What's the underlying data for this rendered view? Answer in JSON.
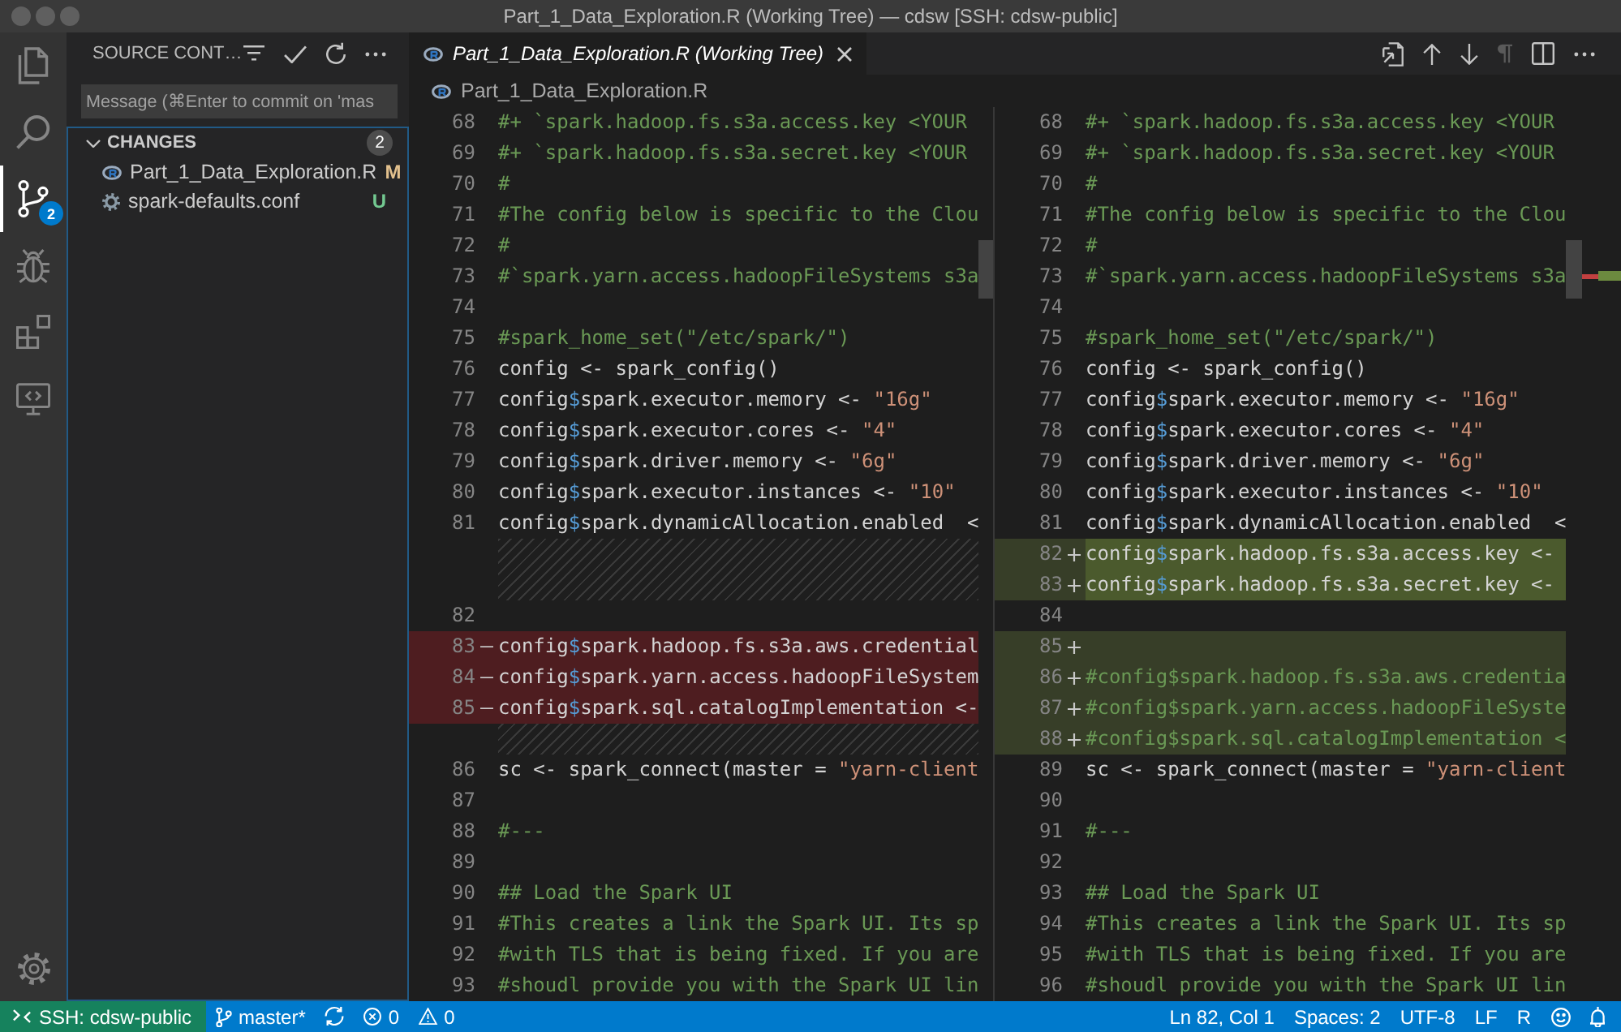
{
  "window": {
    "title": "Part_1_Data_Exploration.R (Working Tree) — cdsw [SSH: cdsw-public]"
  },
  "activity_bar": {
    "items": [
      {
        "kind": "explorer",
        "selected": false
      },
      {
        "kind": "search",
        "selected": false
      },
      {
        "kind": "scm",
        "selected": true,
        "badge": "2"
      },
      {
        "kind": "debug",
        "selected": false
      },
      {
        "kind": "extensions",
        "selected": false
      },
      {
        "kind": "remote",
        "selected": false
      }
    ]
  },
  "sidebar": {
    "title": "SOURCE CONT…",
    "commit_message": {
      "placeholder": "Message (⌘Enter to commit on 'mas"
    },
    "changes": {
      "label": "CHANGES",
      "count": "2",
      "expanded": true,
      "files": [
        {
          "name": "Part_1_Data_Exploration.R",
          "kind": "r",
          "status": "M",
          "color": "#e2c08d",
          "selected": false
        },
        {
          "name": "spark-defaults.conf",
          "kind": "conf",
          "status": "U",
          "color": "#73c991",
          "selected": false
        }
      ]
    }
  },
  "editor": {
    "tabs": [
      {
        "label": "Part_1_Data_Exploration.R (Working Tree)",
        "kind": "r",
        "selected": true
      }
    ],
    "actions": [
      {
        "kind": "open",
        "disabled": false
      },
      {
        "kind": "previous",
        "disabled": false
      },
      {
        "kind": "next",
        "disabled": false
      },
      {
        "kind": "whitespace",
        "disabled": true
      },
      {
        "kind": "split",
        "disabled": false
      },
      {
        "kind": "more",
        "disabled": false
      }
    ],
    "breadcrumb": [
      {
        "label": "Part_1_Data_Exploration.R",
        "kind": "r"
      }
    ],
    "diff": {
      "original": [
        {
          "number": "68",
          "kind": "context",
          "text": "#+ `spark.hadoop.fs.s3a.access.key <YOUR"
        },
        {
          "number": "69",
          "kind": "context",
          "text": "#+ `spark.hadoop.fs.s3a.secret.key <YOUR"
        },
        {
          "number": "70",
          "kind": "context",
          "text": "#"
        },
        {
          "number": "71",
          "kind": "context",
          "text": "#The config below is specific to the Clou"
        },
        {
          "number": "72",
          "kind": "context",
          "text": "#"
        },
        {
          "number": "73",
          "kind": "context",
          "text": "#`spark.yarn.access.hadoopFileSystems s3a"
        },
        {
          "number": "74",
          "kind": "context"
        },
        {
          "number": "75",
          "kind": "context",
          "text": "#spark_home_set(\"/etc/spark/\")"
        },
        {
          "number": "76",
          "kind": "context",
          "text": "config <- spark_config()"
        },
        {
          "number": "77",
          "kind": "context",
          "text": "config$spark.executor.memory <- \"16g\""
        },
        {
          "number": "78",
          "kind": "context",
          "text": "config$spark.executor.cores <- \"4\""
        },
        {
          "number": "79",
          "kind": "context",
          "text": "config$spark.driver.memory <- \"6g\""
        },
        {
          "number": "80",
          "kind": "context",
          "text": "config$spark.executor.instances <- \"10\""
        },
        {
          "number": "81",
          "kind": "context",
          "text": "config$spark.dynamicAllocation.enabled  <"
        },
        {
          "kind": "filler"
        },
        {
          "kind": "filler"
        },
        {
          "number": "82",
          "kind": "context"
        },
        {
          "number": "83",
          "kind": "removed",
          "text": "config$spark.hadoop.fs.s3a.aws.credential"
        },
        {
          "number": "84",
          "kind": "removed",
          "text": "config$spark.yarn.access.hadoopFileSystem"
        },
        {
          "number": "85",
          "kind": "removed",
          "text": "config$spark.sql.catalogImplementation <-"
        },
        {
          "kind": "filler"
        },
        {
          "number": "86",
          "kind": "context",
          "text": "sc <- spark_connect(master = \"yarn-client"
        },
        {
          "number": "87",
          "kind": "context"
        },
        {
          "number": "88",
          "kind": "context",
          "text": "#---"
        },
        {
          "number": "89",
          "kind": "context"
        },
        {
          "number": "90",
          "kind": "context",
          "text": "## Load the Spark UI"
        },
        {
          "number": "91",
          "kind": "context",
          "text": "#This creates a link the Spark UI. Its sp"
        },
        {
          "number": "92",
          "kind": "context",
          "text": "#with TLS that is being fixed. If you are"
        },
        {
          "number": "93",
          "kind": "context",
          "text": "#shoudl provide you with the Spark UI lin"
        }
      ],
      "modified": [
        {
          "number": "68",
          "kind": "context",
          "text": "#+ `spark.hadoop.fs.s3a.access.key <YOUR"
        },
        {
          "number": "69",
          "kind": "context",
          "text": "#+ `spark.hadoop.fs.s3a.secret.key <YOUR"
        },
        {
          "number": "70",
          "kind": "context",
          "text": "#"
        },
        {
          "number": "71",
          "kind": "context",
          "text": "#The config below is specific to the Clou"
        },
        {
          "number": "72",
          "kind": "context",
          "text": "#"
        },
        {
          "number": "73",
          "kind": "context",
          "text": "#`spark.yarn.access.hadoopFileSystems s3a"
        },
        {
          "number": "74",
          "kind": "context"
        },
        {
          "number": "75",
          "kind": "context",
          "text": "#spark_home_set(\"/etc/spark/\")"
        },
        {
          "number": "76",
          "kind": "context",
          "text": "config <- spark_config()"
        },
        {
          "number": "77",
          "kind": "context",
          "text": "config$spark.executor.memory <- \"16g\""
        },
        {
          "number": "78",
          "kind": "context",
          "text": "config$spark.executor.cores <- \"4\""
        },
        {
          "number": "79",
          "kind": "context",
          "text": "config$spark.driver.memory <- \"6g\""
        },
        {
          "number": "80",
          "kind": "context",
          "text": "config$spark.executor.instances <- \"10\""
        },
        {
          "number": "81",
          "kind": "context",
          "text": "config$spark.dynamicAllocation.enabled  <"
        },
        {
          "number": "82",
          "kind": "inserted",
          "text": "config$spark.hadoop.fs.s3a.access.key <-"
        },
        {
          "number": "83",
          "kind": "inserted",
          "text": "config$spark.hadoop.fs.s3a.secret.key <-"
        },
        {
          "number": "84",
          "kind": "context"
        },
        {
          "number": "85",
          "kind": "added"
        },
        {
          "number": "86",
          "kind": "added",
          "text": "#config$spark.hadoop.fs.s3a.aws.credentia"
        },
        {
          "number": "87",
          "kind": "added",
          "text": "#config$spark.yarn.access.hadoopFileSyste"
        },
        {
          "number": "88",
          "kind": "added",
          "text": "#config$spark.sql.catalogImplementation <"
        },
        {
          "number": "89",
          "kind": "context",
          "text": "sc <- spark_connect(master = \"yarn-client"
        },
        {
          "number": "90",
          "kind": "context"
        },
        {
          "number": "91",
          "kind": "context",
          "text": "#---"
        },
        {
          "number": "92",
          "kind": "context"
        },
        {
          "number": "93",
          "kind": "context",
          "text": "## Load the Spark UI"
        },
        {
          "number": "94",
          "kind": "context",
          "text": "#This creates a link the Spark UI. Its sp"
        },
        {
          "number": "95",
          "kind": "context",
          "text": "#with TLS that is being fixed. If you are"
        },
        {
          "number": "96",
          "kind": "context",
          "text": "#shoudl provide you with the Spark UI lin"
        }
      ]
    }
  },
  "status_bar": {
    "remote": "SSH: cdsw-public",
    "branch": "master*",
    "errors": "0",
    "warnings": "0",
    "cursor": "Ln 82, Col 1",
    "indentation": "Spaces: 2",
    "encoding": "UTF-8",
    "line_endings": "LF",
    "language": "R"
  }
}
